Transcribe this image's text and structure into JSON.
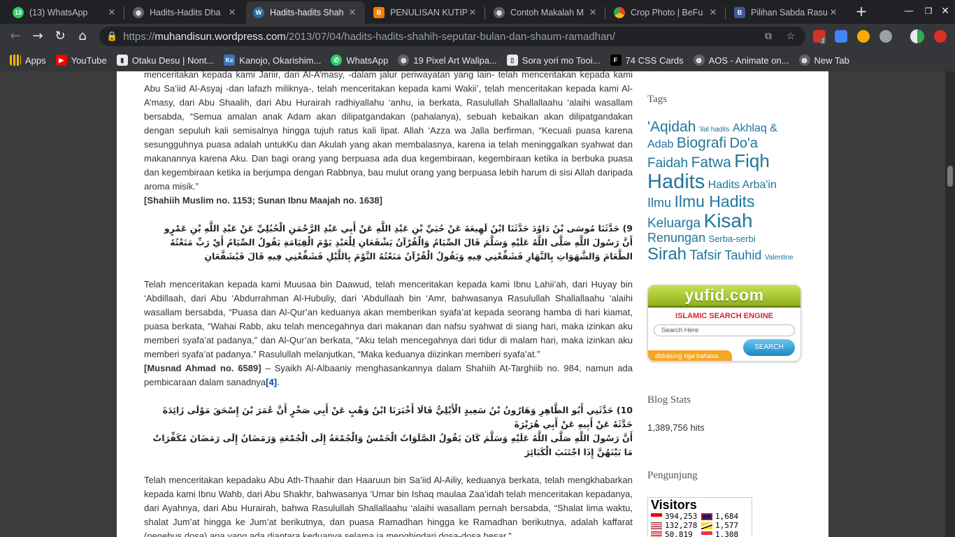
{
  "tabs": [
    {
      "title": "(13) WhatsApp",
      "icon": "whatsapp-icon",
      "badge": "13",
      "color": "#25d366"
    },
    {
      "title": "Hadits-Hadits Dha",
      "icon": "globe-icon",
      "color": "#9aa0a6"
    },
    {
      "title": "Hadits-hadits Shah",
      "icon": "wordpress-icon",
      "color": "#21759b",
      "active": true
    },
    {
      "title": "PENULISAN KUTIP",
      "icon": "blogger-icon",
      "color": "#f57d00"
    },
    {
      "title": "Contoh Makalah M",
      "icon": "globe-icon",
      "color": "#9aa0a6"
    },
    {
      "title": "Crop Photo | BeFu",
      "icon": "chrome-icon",
      "color": "#e8eaed"
    },
    {
      "title": "Pilihan Sabda Rasu",
      "icon": "b-icon",
      "color": "#3b5998"
    }
  ],
  "omnibox": {
    "url_prefix": "https://",
    "url_host": "muhandisun.wordpress.com",
    "url_path": "/2013/07/04/hadits-hadits-shahih-seputar-bulan-dan-shaum-ramadhan/"
  },
  "extensions": {
    "badge": "2"
  },
  "bookmarks": [
    {
      "label": "Apps",
      "icon": "apps-grid-icon",
      "color": "#f4b400"
    },
    {
      "label": "YouTube",
      "icon": "youtube-icon",
      "color": "#ff0000"
    },
    {
      "label": "Otaku Desu | Nont...",
      "icon": "otaku-icon",
      "color": "#e8eaed"
    },
    {
      "label": "Kanojo, Okarishim...",
      "icon": "kc-icon",
      "color": "#3b73b9"
    },
    {
      "label": "WhatsApp",
      "icon": "whatsapp-icon",
      "color": "#25d366"
    },
    {
      "label": "19 Pixel Art Wallpa...",
      "icon": "globe-icon",
      "color": "#9aa0a6"
    },
    {
      "label": "Sora yori mo Tooi...",
      "icon": "page-icon",
      "color": "#e8eaed"
    },
    {
      "label": "74 CSS Cards",
      "icon": "f-icon",
      "color": "#000000"
    },
    {
      "label": "AOS - Animate on...",
      "icon": "globe-icon",
      "color": "#9aa0a6"
    },
    {
      "label": "New Tab",
      "icon": "globe-icon",
      "color": "#9aa0a6"
    }
  ],
  "article": {
    "p1": "menceritakan kepada kami Jariir, dari Al-A’masy, -dalam jalur periwayatan yang lain- telah menceritakan kepada kami Abu Sa’iid Al-Asyaj -dan lafazh miliknya-, telah menceritakan kepada kami Wakii’, telah menceritakan kepada kami Al-A’masy, dari Abu Shaalih, dari Abu Hurairah radhiyallahu ‘anhu, ia berkata, Rasulullah Shallallaahu ‘alaihi wasallam bersabda, “Semua amalan anak Adam akan dilipatgandakan (pahalanya), sebuah kebaikan akan dilipatgandakan dengan sepuluh kali semisalnya hingga tujuh ratus kali lipat. Allah ‘Azza wa Jalla berfirman, “Kecuali puasa karena sesungguhnya puasa adalah untukKu dan Akulah yang akan membalasnya, karena ia telah meninggalkan syahwat dan makanannya karena Aku. Dan bagi orang yang berpuasa ada dua kegembiraan, kegembiraan ketika ia berbuka puasa dan kegembiraan ketika ia berjumpa dengan Rabbnya, bau mulut orang yang berpuasa lebih harum di sisi Allah daripada aroma misik.”",
    "ref1": "[Shahiih Muslim no. 1153; Sunan Ibnu Maajah no. 1638]",
    "ar9a": "9) حَدَّثَنَا مُوسَى بْنُ دَاوُدَ حَدَّثَنَا ابْنُ لَهِيعَةَ عَنْ حُيَيِّ بْنِ عَبْدِ اللَّهِ عَنْ أَبِي عَبْدِ الرَّحْمَنِ الْحُبُلِيِّ عَنْ عَبْدِ اللَّهِ بْنِ عَمْرٍو",
    "ar9b": "أَنَّ رَسُولَ اللَّهِ صَلَّى اللَّهُ عَلَيْهِ وَسَلَّمَ قَالَ الصِّيَامُ وَالْقُرْآنُ يَشْفَعَانِ لِلْعَبْدِ يَوْمَ الْقِيَامَةِ يَقُولُ الصِّيَامُ أَيْ رَبِّ مَنَعْتُهُ الطَّعَامَ وَالشَّهَوَاتِ بِالنَّهَارِ فَشَفِّعْنِي فِيهِ وَيَقُولُ الْقُرْآنُ مَنَعْتُهُ النَّوْمَ بِاللَّيْلِ فَشَفِّعْنِي فِيهِ قَالَ فَيُشَفَّعَانِ",
    "p2": "Telah menceritakan kepada kami Muusaa bin Daawud, telah menceritakan kepada kami Ibnu Lahii’ah, dari Huyay bin ‘Abdillaah, dari Abu ‘Abdurrahman Al-Hubuliy, dari ‘Abdullaah bin ‘Amr, bahwasanya Rasulullah Shallallaahu ‘alaihi wasallam bersabda, “Puasa dan Al-Qur’an keduanya akan memberikan syafa’at kepada seorang hamba di hari kiamat, puasa berkata, “Wahai Rabb, aku telah mencegahnya dari makanan dan nafsu syahwat di siang hari, maka izinkan aku memberi syafa’at padanya,” dan Al-Qur’an berkata, “Aku telah mencegahnya dari tidur di malam hari, maka izinkan aku memberi syafa’at padanya.” Rasulullah melanjutkan, “Maka keduanya diizinkan memberi syafa’at.”",
    "ref2": "[Musnad Ahmad no. 6589]",
    "ref2_rest": " – Syaikh Al-Albaaniy menghasankannya dalam Shahiih At-Targhiib no. 984, namun ada pembicaraan dalam sanadnya",
    "fn2": "[4]",
    "fn2_end": ".",
    "ar10a": "10) حَدَّثَنِي أَبُو الطَّاهِرِ وَهَارُونُ بْنُ سَعِيدٍ الْأَيْلِيُّ قَالَا أَخْبَرَنَا ابْنُ وَهْبٍ عَنْ أَبِي صَخْرٍ أَنَّ عُمَرَ بْنَ إِسْحَقَ مَوْلَى زَائِدَةَ حَدَّثَهُ عَنْ أَبِيهِ عَنْ أَبِي هُرَيْرَةَ",
    "ar10b": "أَنَّ رَسُولَ اللَّهِ صَلَّى اللَّهُ عَلَيْهِ وَسَلَّمَ كَانَ يَقُولُ الصَّلَوَاتُ الْخَمْسُ وَالْجُمْعَةُ إِلَى الْجُمْعَةِ وَرَمَضَانُ إِلَى رَمَضَانَ مُكَفِّرَاتٌ مَا بَيْنَهُنَّ إِذَا اجْتَنَبَ الْكَبَائِرَ",
    "p3": "Telah menceritakan kepadaku Abu Ath-Thaahir dan Haaruun bin Sa’iid Al-Ailiy, keduanya berkata, telah mengkhabarkan kepada kami Ibnu Wahb, dari Abu Shakhr, bahwasanya ‘Umar bin Ishaq maulaa Zaa’idah telah menceritakan kepadanya, dari Ayahnya, dari Abu Hurairah, bahwa Rasulullah Shallallaahu ‘alaihi wasallam pernah bersabda, “Shalat lima waktu, shalat Jum’at hingga ke Jum’at berikutnya, dan puasa Ramadhan hingga ke Ramadhan berikutnya, adalah kaffarat (penebus dosa) apa yang ada diantara keduanya selama ia menghindari dosa-dosa besar.”"
  },
  "sidebar": {
    "tags_title": "Tags",
    "tags": [
      {
        "label": "'Aqidah",
        "size": 21
      },
      {
        "label": "'ilal hadits",
        "size": 10
      },
      {
        "label": "Akhlaq & Adab",
        "size": 16
      },
      {
        "label": "Biografi",
        "size": 21
      },
      {
        "label": "Do'a",
        "size": 20
      },
      {
        "label": "Faidah",
        "size": 19
      },
      {
        "label": "Fatwa",
        "size": 21
      },
      {
        "label": "Fiqh",
        "size": 26
      },
      {
        "label": "Hadits",
        "size": 29
      },
      {
        "label": "Hadits Arba'in",
        "size": 16
      },
      {
        "label": "Ilmu",
        "size": 18
      },
      {
        "label": "Ilmu Hadits",
        "size": 23
      },
      {
        "label": "Keluarga",
        "size": 19
      },
      {
        "label": "Kisah",
        "size": 28
      },
      {
        "label": "Renungan",
        "size": 18
      },
      {
        "label": "Serba-serbi",
        "size": 13
      },
      {
        "label": "Sirah",
        "size": 24
      },
      {
        "label": "Tafsir",
        "size": 19
      },
      {
        "label": "Tauhid",
        "size": 18
      },
      {
        "label": "Valentine",
        "size": 10
      }
    ],
    "yufid": {
      "logo": "yufid.com",
      "subtitle": "ISLAMIC SEARCH ENGINE",
      "placeholder": "Search Here",
      "button": "SEARCH",
      "tagline": "didukung tiga bahasa"
    },
    "stats_title": "Blog Stats",
    "hits": "1,389,756 hits",
    "visitors_title": "Pengunjung",
    "visitors_label": "Visitors",
    "visitors": [
      {
        "count": "394,253",
        "flag": "indonesia"
      },
      {
        "count": "1,684",
        "flag": "uk"
      },
      {
        "count": "132,278",
        "flag": "usa"
      },
      {
        "count": "1,577",
        "flag": "brunei"
      },
      {
        "count": "50,819",
        "flag": "malaysia"
      },
      {
        "count": "1,308",
        "flag": "singapore"
      }
    ]
  }
}
